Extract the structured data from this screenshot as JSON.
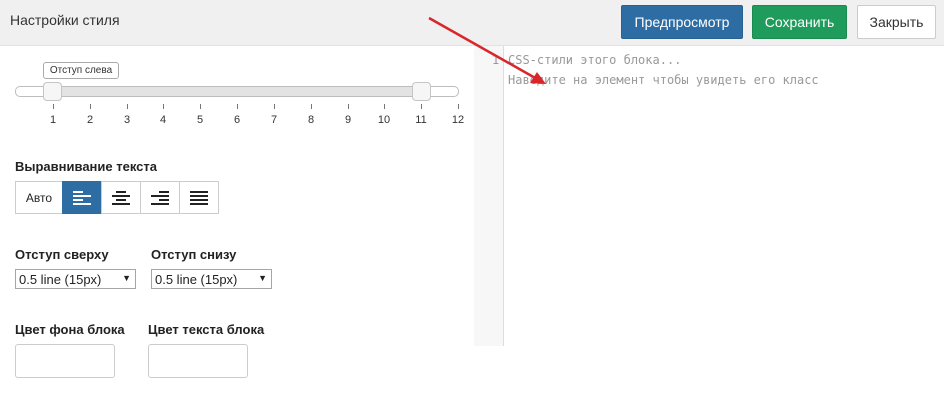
{
  "header": {
    "title": "Настройки стиля",
    "preview_label": "Предпросмотр",
    "save_label": "Сохранить",
    "close_label": "Закрыть"
  },
  "indent": {
    "tooltip": "Отступ слева",
    "ticks": [
      "1",
      "2",
      "3",
      "4",
      "5",
      "6",
      "7",
      "8",
      "9",
      "10",
      "11",
      "12"
    ],
    "range_start": 1,
    "range_end": 11
  },
  "text_align": {
    "label": "Выравнивание текста",
    "auto_label": "Авто",
    "options": [
      "align-left-icon",
      "align-center-icon",
      "align-right-icon",
      "align-justify-icon"
    ],
    "selected": "align-left-icon"
  },
  "margin_top": {
    "label": "Отступ сверху",
    "value": "0.5 line (15px)"
  },
  "margin_bottom": {
    "label": "Отступ снизу",
    "value": "0.5 line (15px)"
  },
  "bg_color": {
    "label": "Цвет фона блока",
    "value": ""
  },
  "text_color": {
    "label": "Цвет текста блока",
    "value": ""
  },
  "editor": {
    "line_number": "1",
    "line1": "CSS-стили этого блока...",
    "line2": "Наведите на элемент чтобы увидеть его класс"
  },
  "colors": {
    "primary": "#2e6da4",
    "success": "#1f9c5b",
    "annotation_arrow": "#d9262b"
  }
}
